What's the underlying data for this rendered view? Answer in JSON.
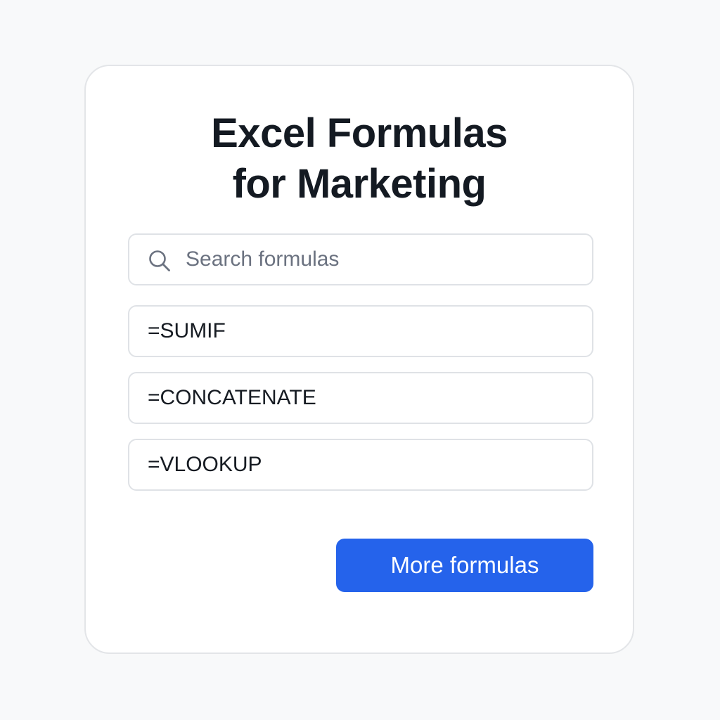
{
  "title": {
    "line1": "Excel Formulas",
    "line2": "for Marketing"
  },
  "search": {
    "placeholder": "Search formulas",
    "value": "",
    "icon": "search-icon"
  },
  "formulas": [
    {
      "label": "=SUMIF"
    },
    {
      "label": "=CONCATENATE"
    },
    {
      "label": "=VLOOKUP"
    }
  ],
  "more_button": {
    "label": "More formulas"
  },
  "colors": {
    "accent": "#2563eb",
    "title_text": "#141a22",
    "border": "#dfe2e6",
    "background": "#f8f9fa"
  }
}
